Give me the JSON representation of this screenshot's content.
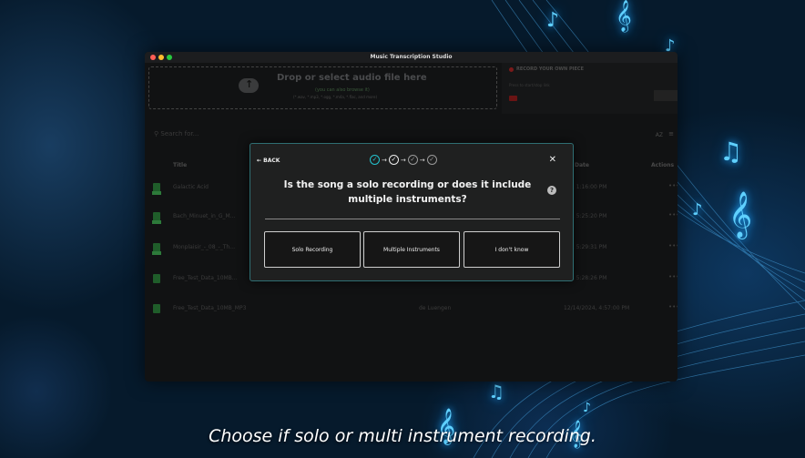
{
  "window": {
    "title": "Music Transcription Studio"
  },
  "dropzone": {
    "title": "Drop or select audio file here",
    "subtitle": "(you can also browse it)",
    "types": "(*.wav, *.mp3, *.ogg, *.m4a, *.flac, and more)"
  },
  "record": {
    "title": "RECORD YOUR OWN PIECE",
    "subtitle": "Press to start/stop link"
  },
  "search": {
    "placeholder": "Search for..."
  },
  "toolbar": {
    "sort_label": "AZ"
  },
  "table": {
    "columns": {
      "title": "Title",
      "date": "Date",
      "actions": "Actions"
    },
    "rows": [
      {
        "name": "Galactic Acid",
        "artist": "",
        "date": "…4, 1:16:00 PM",
        "actions": "•••"
      },
      {
        "name": "Bach_Minuet_in_G_M…",
        "artist": "",
        "date": "…4, 5:25:20 PM",
        "actions": "•••"
      },
      {
        "name": "Monplaisir_-_08_-_Th…",
        "artist": "",
        "date": "…4, 5:29:31 PM",
        "actions": "•••"
      },
      {
        "name": "Free_Test_Data_10MB…",
        "artist": "",
        "date": "…4, 5:28:26 PM",
        "actions": "•••"
      },
      {
        "name": "Free_Test_Data_10MB_MP3",
        "artist": "de Luengen",
        "date": "12/14/2024, 4:57:00 PM",
        "actions": "•••"
      }
    ]
  },
  "modal": {
    "back_label": "← BACK",
    "close_label": "✕",
    "steps": [
      {
        "state": "done",
        "glyph": "✓"
      },
      {
        "state": "current",
        "glyph": "✓"
      },
      {
        "state": "todo",
        "glyph": "✓"
      },
      {
        "state": "todo",
        "glyph": "✓"
      }
    ],
    "arrow": "→",
    "question": "Is the song a solo recording or does it include multiple instruments?",
    "help_glyph": "?",
    "options": [
      {
        "label": "Solo Recording"
      },
      {
        "label": "Multiple Instruments"
      },
      {
        "label": "I don't know"
      }
    ]
  },
  "caption": "Choose if solo or multi instrument recording.",
  "colors": {
    "accent": "#24c3cf",
    "background": "#061a2c",
    "modal_border": "#2f6e73",
    "note_glow": "#5fd0ff"
  }
}
